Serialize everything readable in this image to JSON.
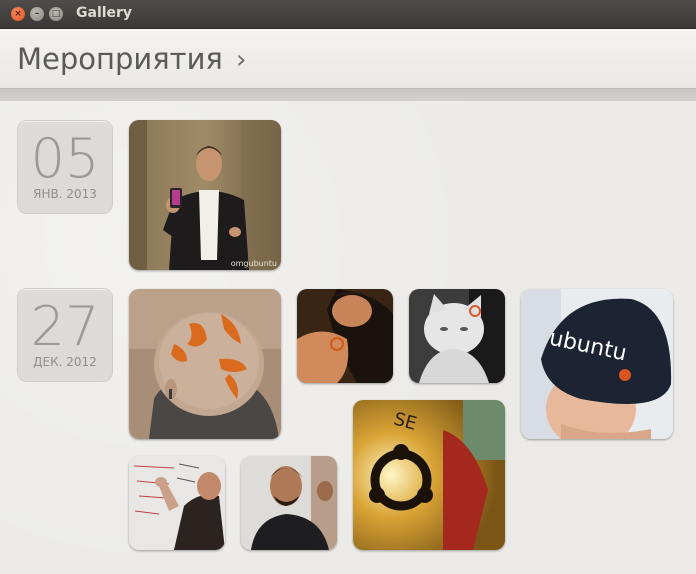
{
  "window": {
    "title": "Gallery"
  },
  "header": {
    "title": "Мероприятия",
    "chevron": "›"
  },
  "events": [
    {
      "day": "05",
      "month_year": "ЯНВ. 2013"
    },
    {
      "day": "27",
      "month_year": "ДЕК. 2012"
    }
  ],
  "photo_watermark": "omgubuntu",
  "icons": [
    "close-icon",
    "minimize-icon",
    "maximize-icon",
    "chevron-right-icon"
  ]
}
